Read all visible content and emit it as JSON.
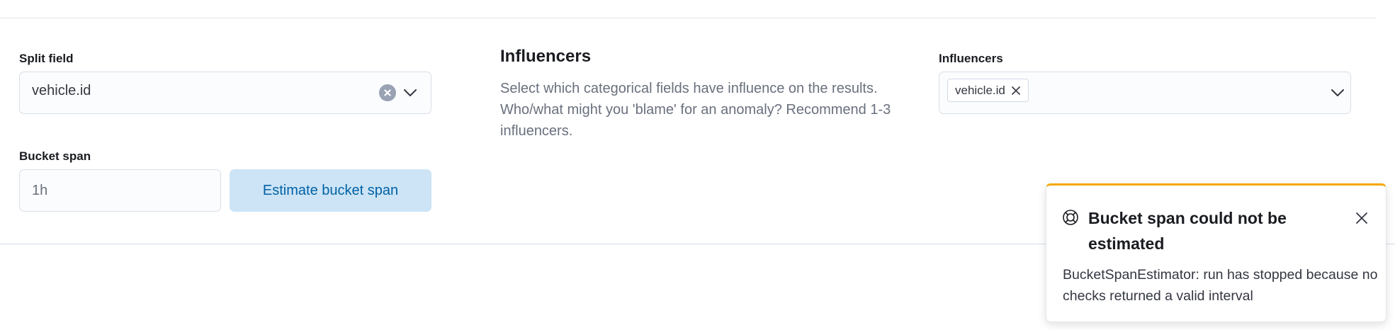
{
  "split_field": {
    "label": "Split field",
    "value": "vehicle.id"
  },
  "bucket_span": {
    "label": "Bucket span",
    "value": "1h",
    "estimate_button_label": "Estimate bucket span"
  },
  "influencers_help": {
    "title": "Influencers",
    "description": "Select which categorical fields have influence on the results. Who/what might you 'blame' for an anomaly? Recommend 1-3 influencers."
  },
  "influencers_field": {
    "label": "Influencers",
    "selected": [
      "vehicle.id"
    ]
  },
  "toast": {
    "icon": "lifebuoy-icon",
    "title": "Bucket span could not be estimated",
    "message": "BucketSpanEstimator: run has stopped because no checks returned a valid interval",
    "accent_color": "#f5a700"
  },
  "colors": {
    "primary_text": "#1a1c21",
    "secondary_text": "#69707d",
    "button_bg": "#cce4f5",
    "button_text": "#0061a6"
  }
}
